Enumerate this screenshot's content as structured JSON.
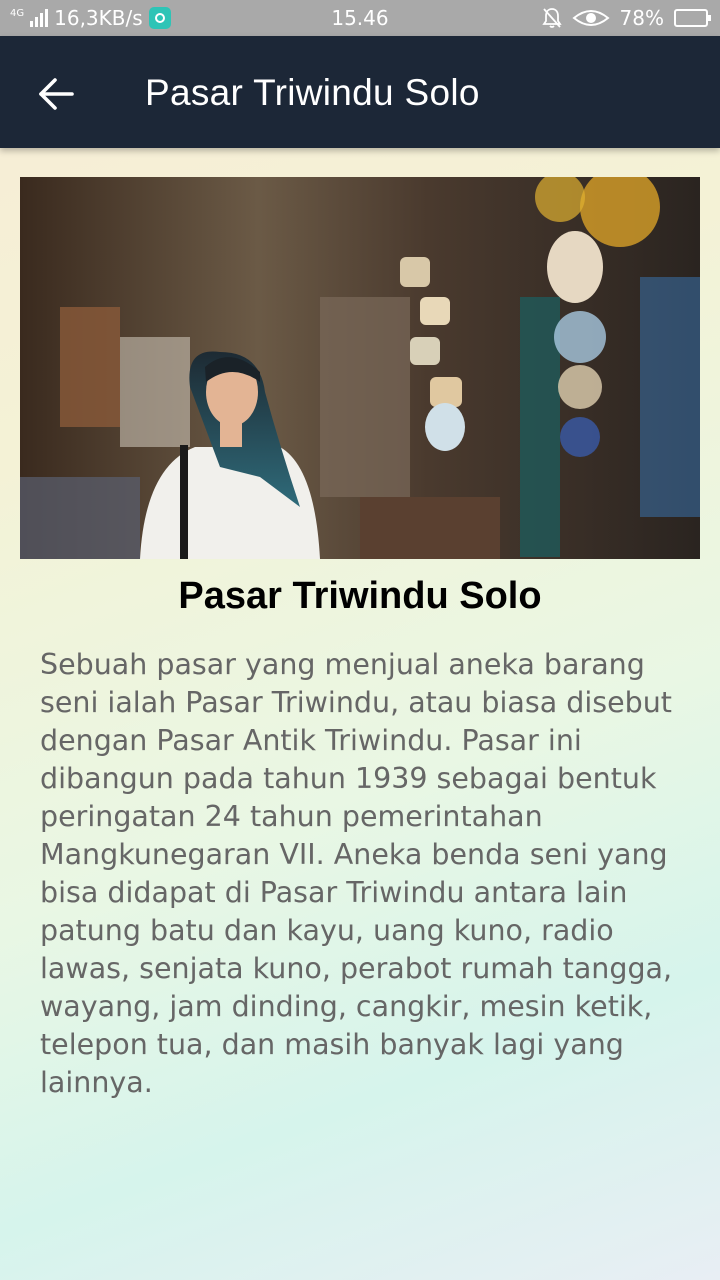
{
  "status_bar": {
    "network_type": "4G",
    "speed": "16,3KB/s",
    "time": "15.46",
    "battery": "78%",
    "battery_level": 0.78
  },
  "app_bar": {
    "title": "Pasar Triwindu Solo",
    "back_icon": "arrow-left-icon"
  },
  "content": {
    "title": "Pasar Triwindu Solo",
    "description": "Sebuah pasar yang menjual aneka barang seni ialah Pasar Triwindu, atau biasa disebut dengan Pasar Antik Triwindu. Pasar ini dibangun pada tahun 1939 sebagai bentuk peringatan 24 tahun pemerintahan Mangkunegaran VII. Aneka benda seni yang bisa didapat di Pasar Triwindu antara lain patung batu dan kayu, uang kuno, radio lawas, senjata kuno, perabot rumah tangga, wayang, jam dinding, cangkir, mesin ketik, telepon tua, dan masih banyak lagi yang lainnya."
  },
  "colors": {
    "app_bar": "#1c2737",
    "status_bar": "#a9a9a9",
    "body_text": "#666666"
  }
}
